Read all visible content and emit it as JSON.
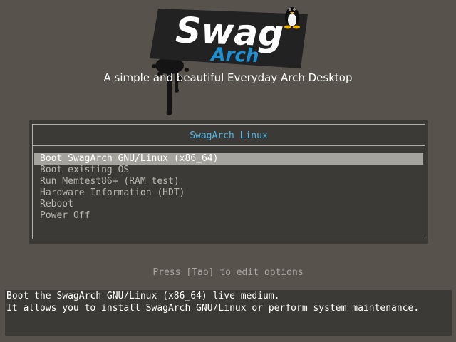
{
  "logo": {
    "word": "Swag",
    "subword": "Arch"
  },
  "tagline": "A simple and beautiful Everyday Arch Desktop",
  "menu": {
    "title": "SwagArch Linux",
    "items": [
      {
        "label": "Boot SwagArch GNU/Linux (x86_64)",
        "selected": true
      },
      {
        "label": "Boot existing OS",
        "selected": false
      },
      {
        "label": "Run Memtest86+ (RAM test)",
        "selected": false
      },
      {
        "label": "Hardware Information (HDT)",
        "selected": false
      },
      {
        "label": "Reboot",
        "selected": false
      },
      {
        "label": "Power Off",
        "selected": false
      }
    ]
  },
  "hint": "Press [Tab] to edit options",
  "help": {
    "line1": "Boot the SwagArch GNU/Linux (x86_64) live medium.",
    "line2": "It allows you to install SwagArch GNU/Linux or perform system maintenance."
  },
  "colors": {
    "background": "#57534c",
    "menu_background": "#3c3a36",
    "accent_title": "#4fb8e8",
    "logo_arch_blue": "#1e8fd0",
    "selected_bg": "#a5a39e"
  },
  "icons": {
    "mascot": "tux-penguin-icon",
    "splash": "paint-drip-icon"
  }
}
